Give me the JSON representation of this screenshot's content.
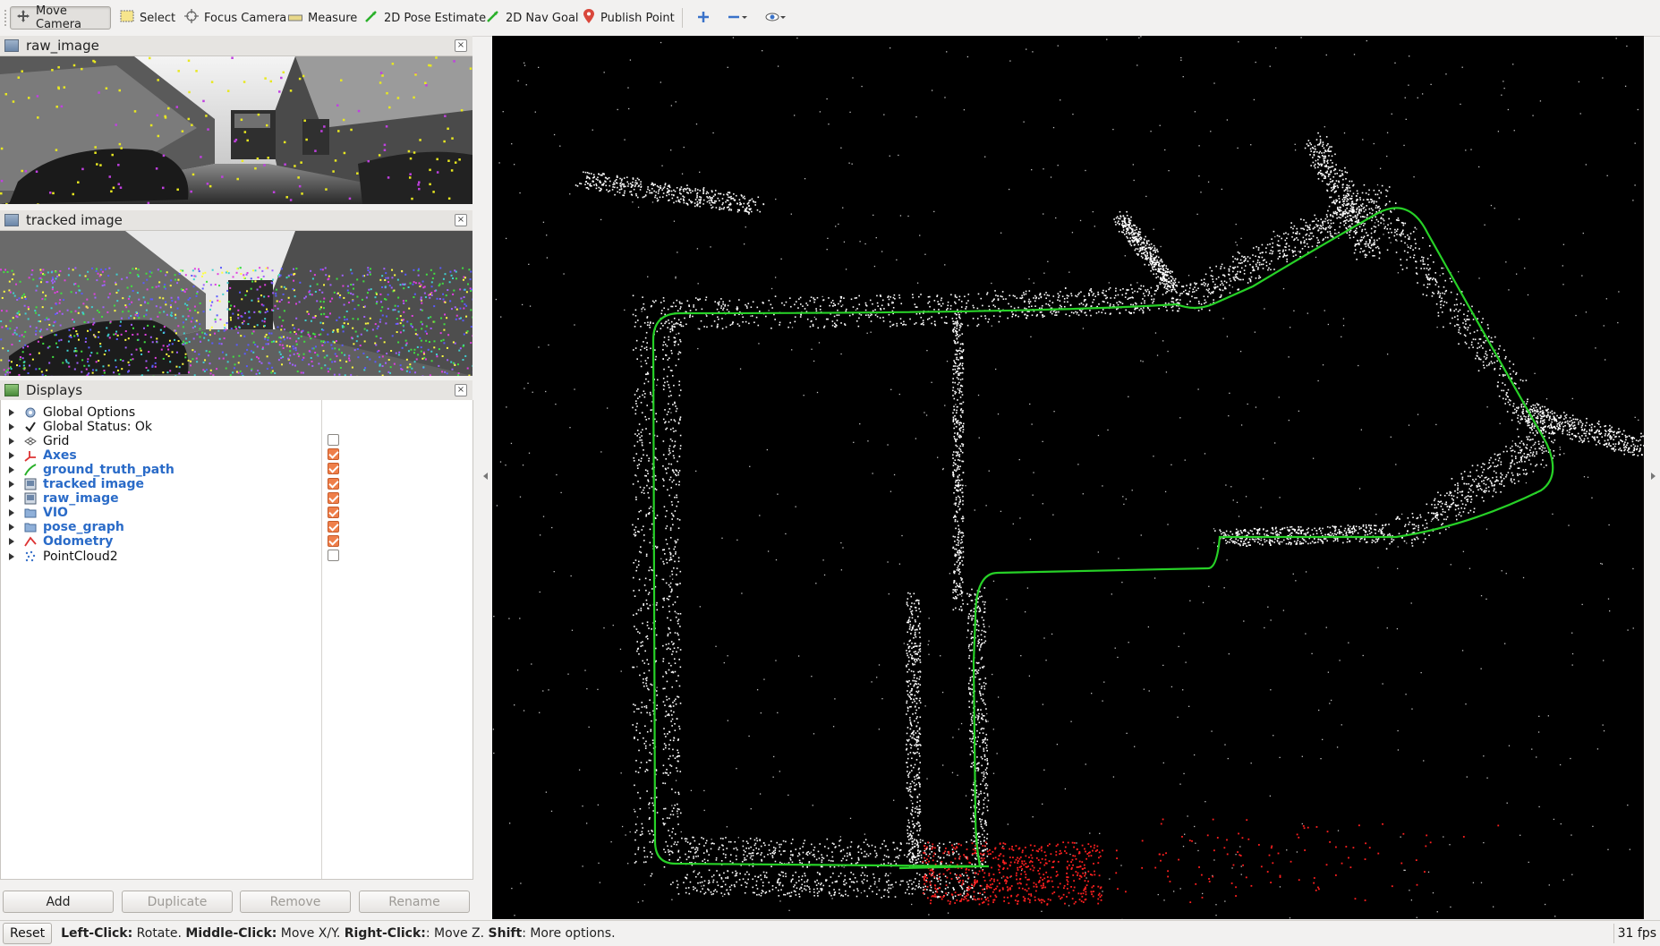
{
  "toolbar": {
    "tools": [
      {
        "label": "Move Camera",
        "icon": "move-camera-icon",
        "active": true
      },
      {
        "label": "Select",
        "icon": "select-icon",
        "active": false
      },
      {
        "label": "Focus Camera",
        "icon": "focus-camera-icon",
        "active": false
      },
      {
        "label": "Measure",
        "icon": "measure-icon",
        "active": false
      },
      {
        "label": "2D Pose Estimate",
        "icon": "pose-estimate-icon",
        "active": false
      },
      {
        "label": "2D Nav Goal",
        "icon": "nav-goal-icon",
        "active": false
      },
      {
        "label": "Publish Point",
        "icon": "publish-point-icon",
        "active": false
      }
    ]
  },
  "panels": {
    "raw_image": {
      "title": "raw_image"
    },
    "tracked_image": {
      "title": "tracked image"
    },
    "displays": {
      "title": "Displays"
    }
  },
  "displays": {
    "items": [
      {
        "label": "Global Options",
        "icon": "gear-icon",
        "checkable": false,
        "checked": false,
        "enabled": false
      },
      {
        "label": "Global Status: Ok",
        "icon": "checkmark-icon",
        "checkable": false,
        "checked": false,
        "enabled": false
      },
      {
        "label": "Grid",
        "icon": "grid-icon",
        "checkable": true,
        "checked": false,
        "enabled": false
      },
      {
        "label": "Axes",
        "icon": "axes-icon",
        "checkable": true,
        "checked": true,
        "enabled": true
      },
      {
        "label": "ground_truth_path",
        "icon": "path-icon",
        "checkable": true,
        "checked": true,
        "enabled": true
      },
      {
        "label": "tracked image",
        "icon": "image-icon",
        "checkable": true,
        "checked": true,
        "enabled": true
      },
      {
        "label": "raw_image",
        "icon": "image-icon",
        "checkable": true,
        "checked": true,
        "enabled": true
      },
      {
        "label": "VIO",
        "icon": "folder-icon",
        "checkable": true,
        "checked": true,
        "enabled": true
      },
      {
        "label": "pose_graph",
        "icon": "folder-icon",
        "checkable": true,
        "checked": true,
        "enabled": true
      },
      {
        "label": "Odometry",
        "icon": "odometry-icon",
        "checkable": true,
        "checked": true,
        "enabled": true
      },
      {
        "label": "PointCloud2",
        "icon": "pointcloud-icon",
        "checkable": true,
        "checked": false,
        "enabled": false
      }
    ],
    "buttons": {
      "add": "Add",
      "duplicate": "Duplicate",
      "remove": "Remove",
      "rename": "Rename"
    }
  },
  "status": {
    "reset": "Reset",
    "hints": [
      {
        "key": "Left-Click:",
        "text": " Rotate. "
      },
      {
        "key": "Middle-Click:",
        "text": " Move X/Y. "
      },
      {
        "key": "Right-Click:",
        "text": ": Move Z. "
      },
      {
        "key": "Shift",
        "text": ": More options."
      }
    ],
    "fps": "31 fps"
  },
  "colors": {
    "path": "#27d127",
    "points": "#ffffff",
    "odom_points": "#ff2020",
    "enabled_text": "#2a6bc8"
  }
}
